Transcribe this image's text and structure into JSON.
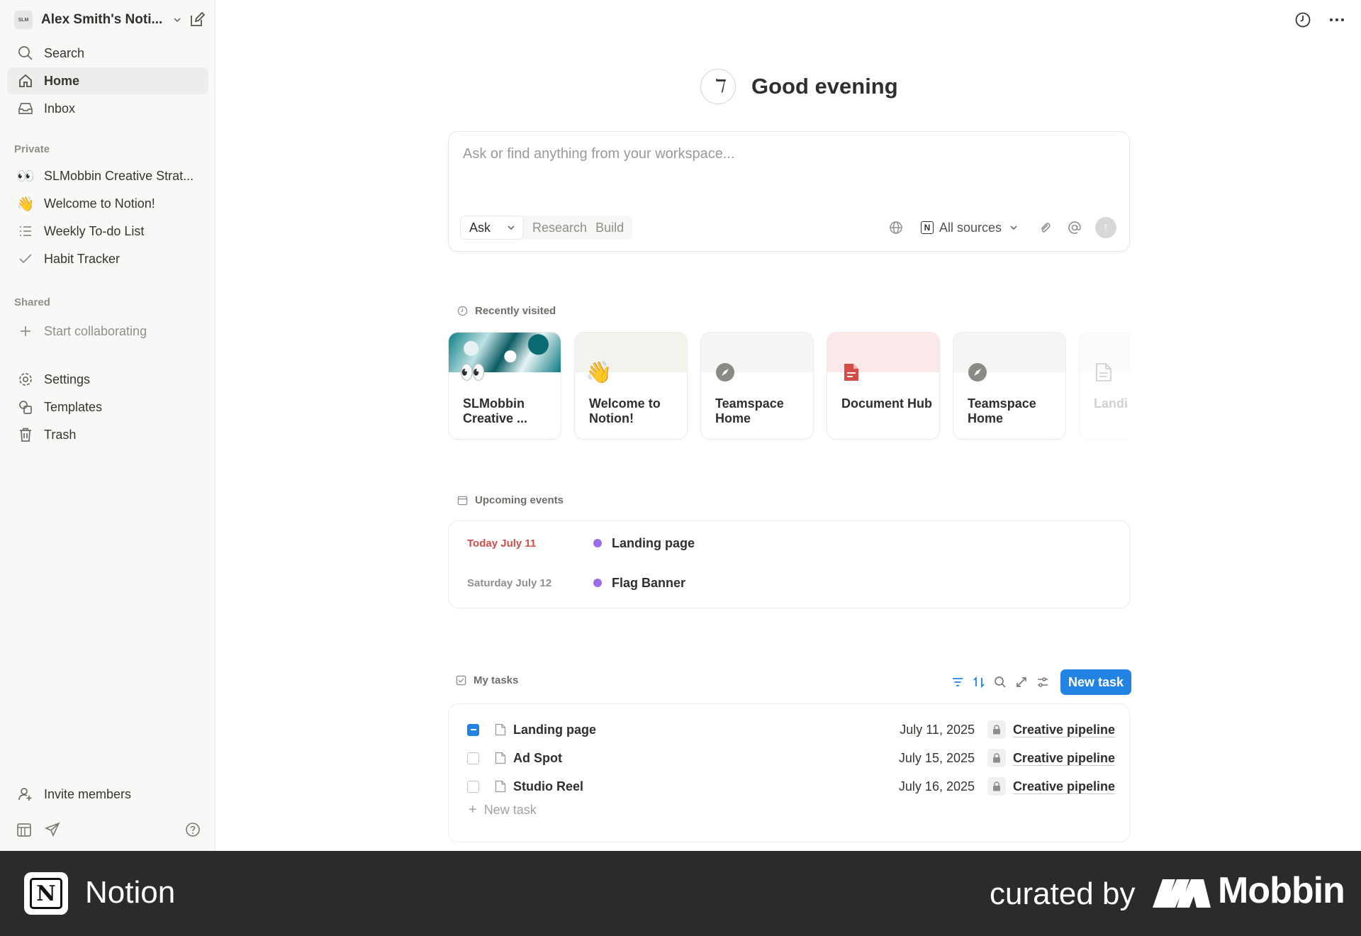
{
  "sidebar": {
    "workspace_name": "Alex Smith's Noti...",
    "workspace_logo_text": "SLM",
    "nav": {
      "search": "Search",
      "home": "Home",
      "inbox": "Inbox"
    },
    "private_label": "Private",
    "private_items": [
      {
        "emoji": "👀",
        "label": "SLMobbin Creative Strat..."
      },
      {
        "emoji": "👋",
        "label": "Welcome to Notion!"
      },
      {
        "emoji": "",
        "label": "Weekly To-do List"
      },
      {
        "emoji": "",
        "label": "Habit Tracker"
      }
    ],
    "shared_label": "Shared",
    "start_collab": "Start collaborating",
    "settings": "Settings",
    "templates": "Templates",
    "trash": "Trash",
    "invite": "Invite members"
  },
  "greeting": {
    "avatar_glyph": "ℸ",
    "text": "Good evening"
  },
  "ask": {
    "placeholder": "Ask or find anything from your workspace...",
    "modes": [
      "Ask",
      "Research",
      "Build"
    ],
    "sources_label": "All sources"
  },
  "recent": {
    "heading": "Recently visited",
    "cards": [
      {
        "title": "SLMobbin Creative ...",
        "icon": "👀"
      },
      {
        "title": "Welcome to Notion!",
        "icon": "👋"
      },
      {
        "title": "Teamspace Home",
        "icon": "compass-icon"
      },
      {
        "title": "Document Hub",
        "icon": "document-red-icon"
      },
      {
        "title": "Teamspace Home",
        "icon": "compass-icon"
      },
      {
        "title": "Landi",
        "icon": "page-icon"
      }
    ]
  },
  "events": {
    "heading": "Upcoming events",
    "items": [
      {
        "date": "Today July 11",
        "title": "Landing page"
      },
      {
        "date": "Saturday July 12",
        "title": "Flag Banner"
      }
    ]
  },
  "tasks": {
    "heading": "My tasks",
    "new_button": "New task",
    "rows": [
      {
        "name": "Landing page",
        "date": "July 11, 2025",
        "project": "Creative pipeline",
        "checked": true
      },
      {
        "name": "Ad Spot",
        "date": "July 15, 2025",
        "project": "Creative pipeline",
        "checked": false
      },
      {
        "name": "Studio Reel",
        "date": "July 16, 2025",
        "project": "Creative pipeline",
        "checked": false
      }
    ],
    "add_label": "New task"
  },
  "footer": {
    "app_name": "Notion",
    "curated": "curated by",
    "brand": "Mobbin"
  },
  "colors": {
    "accent": "#2383e2",
    "event_dot": "#9b6ce6",
    "today": "#d44c47"
  }
}
